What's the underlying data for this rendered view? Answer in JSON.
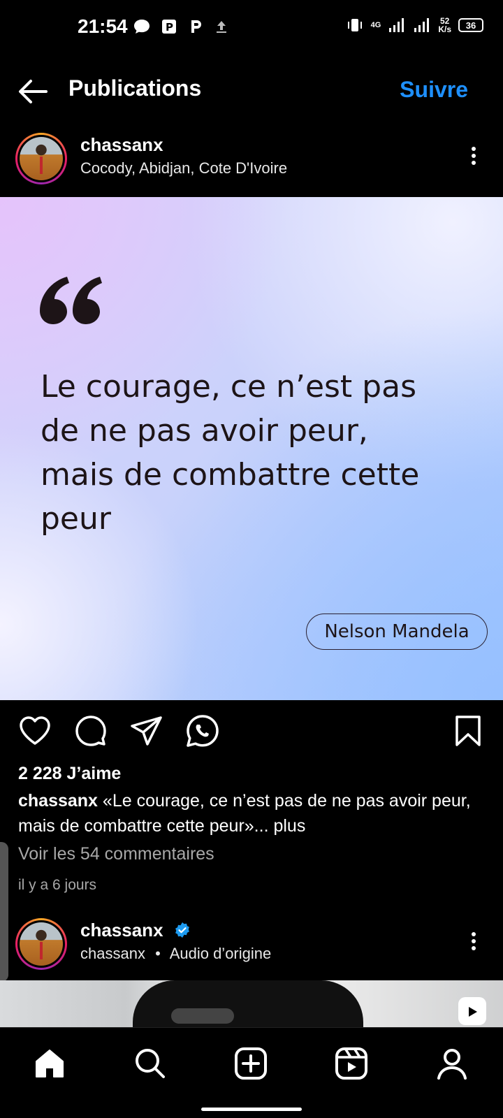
{
  "status_bar": {
    "time": "21:54",
    "network_label": "4G",
    "speed_value": "52",
    "speed_unit": "K/s",
    "battery": "36"
  },
  "header": {
    "title": "Publications",
    "follow_label": "Suivre"
  },
  "post": {
    "username": "chassanx",
    "location": "Cocody, Abidjan, Cote D'Ivoire",
    "image": {
      "quote": "Le courage, ce n’est pas de ne pas avoir peur, mais de combattre cette peur",
      "author": "Nelson Mandela"
    },
    "likes": "2 228 J’aime",
    "caption_user": "chassanx",
    "caption_text": " «Le courage, ce n’est pas de ne pas avoir peur, mais de combattre cette peur»...",
    "caption_more": " plus",
    "comments_link": "Voir les 54 commentaires",
    "time_ago": "il y a 6 jours"
  },
  "next_post": {
    "username": "chassanx",
    "audio_user": "chassanx",
    "audio_separator": "•",
    "audio_label": "Audio d’origine"
  },
  "icons": {
    "back": "arrow-left-icon",
    "more": "more-vertical-icon",
    "like": "heart-icon",
    "comment": "comment-icon",
    "share": "send-icon",
    "whatsapp": "whatsapp-icon",
    "save": "bookmark-icon",
    "nav": [
      "home-icon",
      "search-icon",
      "create-icon",
      "reels-icon",
      "profile-icon"
    ]
  },
  "colors": {
    "accent": "#1e90ff",
    "background": "#000000",
    "muted_text": "#a8a8a8",
    "verified": "#1d9bf0"
  }
}
